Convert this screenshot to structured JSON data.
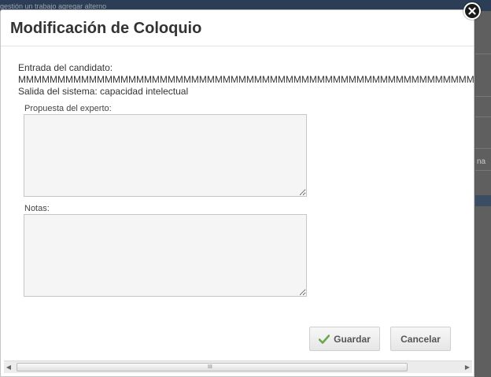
{
  "background": {
    "breadcrumb": "gestión un trabajo  agregar alterno",
    "row_fragment": "na"
  },
  "dialog": {
    "title": "Modificación de Coloquio",
    "candidate_input_label": "Entrada del candidato:",
    "candidate_input_value": "MMMMMMMMMMMMMMMMMMMMMMMMMMMMMMMMMMMMMMMMMMMMMMMMMMMMMMMMMMMMMMMMM",
    "system_output": "Salida del sistema: capacidad intelectual",
    "expert_proposal_label": "Propuesta del experto:",
    "expert_proposal_value": "",
    "notes_label": "Notas:",
    "notes_value": "",
    "save_label": "Guardar",
    "cancel_label": "Cancelar"
  },
  "scrollbar": {
    "grip": "III"
  },
  "colors": {
    "accent_check": "#6aa84f",
    "title_text": "#333333",
    "overlay": "#4d4d4d"
  },
  "icons": {
    "save": "check-icon",
    "close": "close-icon"
  }
}
